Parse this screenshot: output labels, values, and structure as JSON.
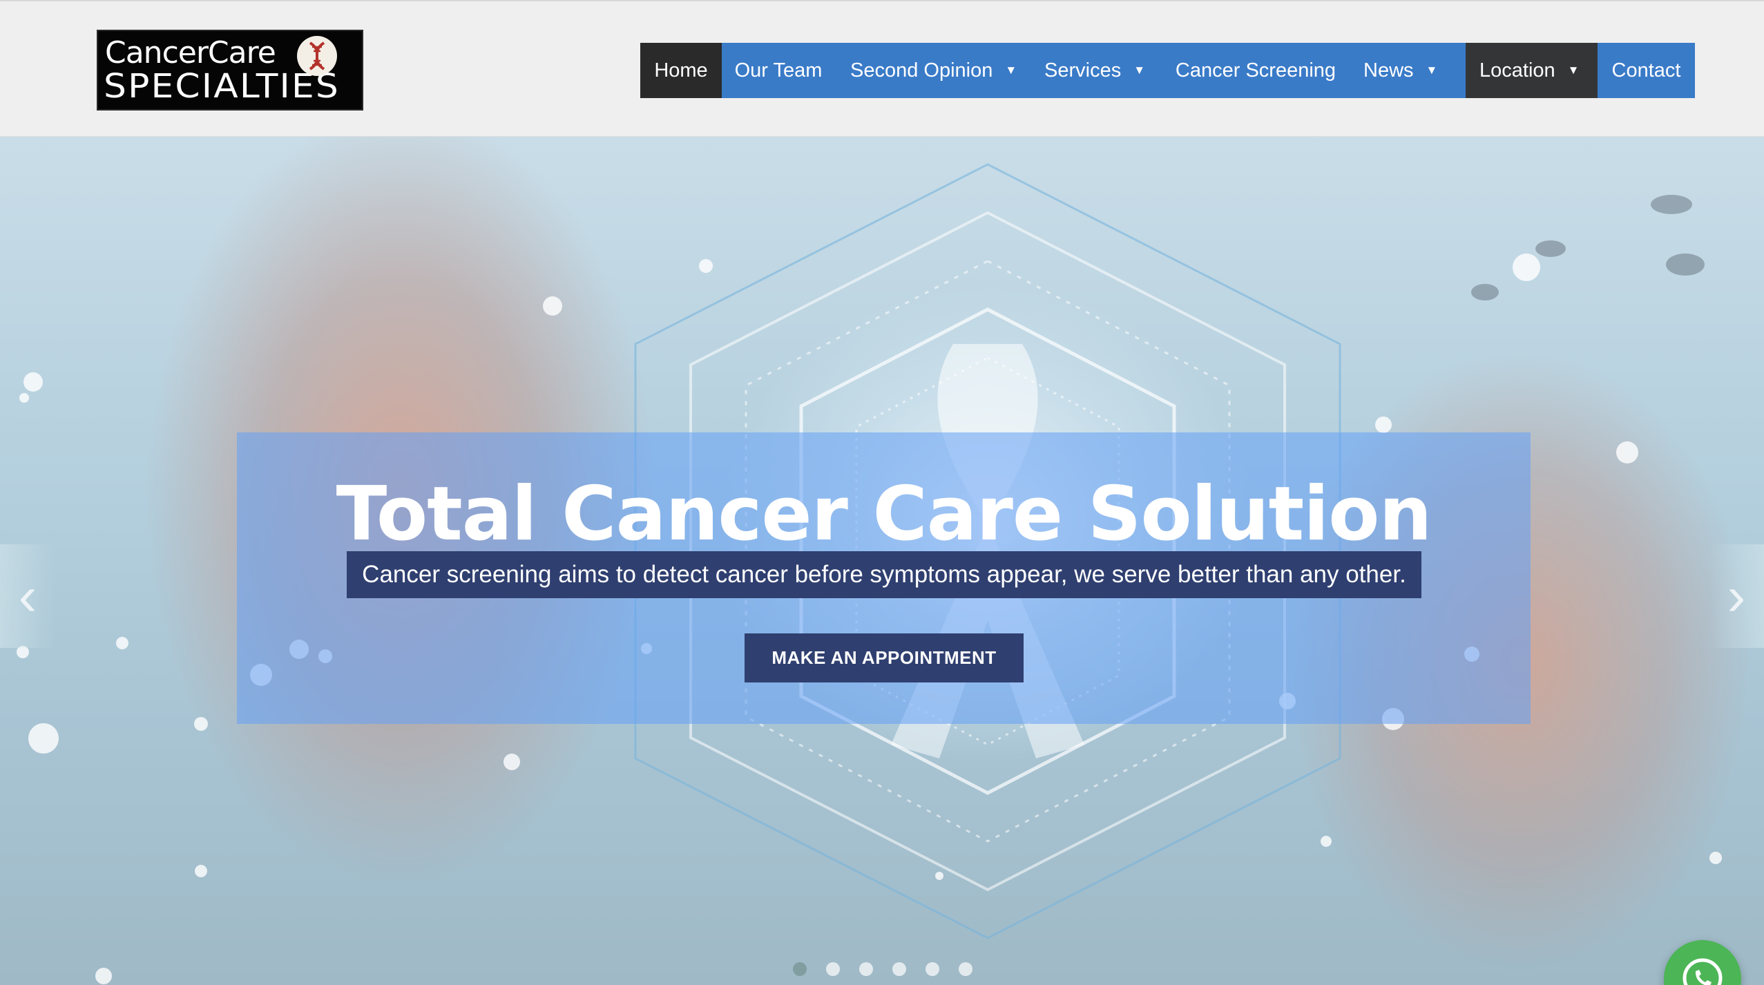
{
  "brand": {
    "logo_line1": "CancerCare",
    "logo_line2": "SPECIALTIES",
    "logo_badge_icon": "dna-icon"
  },
  "nav": {
    "items": [
      {
        "label": "Home",
        "active": true,
        "has_dropdown": false
      },
      {
        "label": "Our Team",
        "has_dropdown": false
      },
      {
        "label": "Second Opinion",
        "has_dropdown": true
      },
      {
        "label": "Services",
        "has_dropdown": true
      },
      {
        "label": "Cancer Screening",
        "has_dropdown": false
      },
      {
        "label": "News",
        "has_dropdown": true
      },
      {
        "label": "Location",
        "has_dropdown": true
      },
      {
        "label": "Contact",
        "has_dropdown": false
      }
    ],
    "caret": "▼"
  },
  "hero": {
    "title": "Total Cancer Care Solution",
    "subtitle": "Cancer screening aims to detect cancer before symptoms appear, we serve better than any other.",
    "cta_label": "MAKE AN APPOINTMENT",
    "prev_arrow": "‹",
    "next_arrow": "›",
    "slides_count": 6,
    "active_slide": 1
  },
  "floating": {
    "whatsapp_icon": "whatsapp-icon"
  },
  "colors": {
    "nav_blue": "#3a7bc8",
    "nav_dark": "#2a2a2a",
    "overlay_blue": "#64a0f5",
    "banner_navy": "#2f3f70",
    "whatsapp_green": "#4cb556"
  }
}
